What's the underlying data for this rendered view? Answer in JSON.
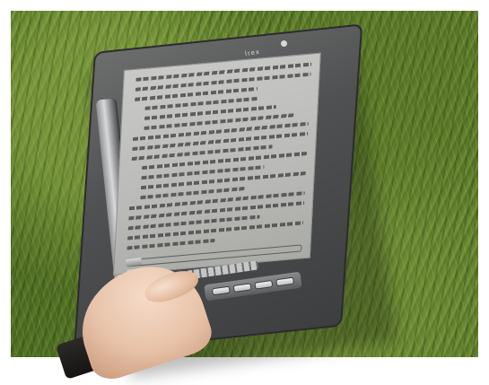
{
  "photo": {
    "subject": "e-book-reader",
    "background": "grass",
    "brand_text": "lrex"
  },
  "colors": {
    "grass": "#5f7d2e",
    "device_body": "#505152",
    "screen": "#b9bab7",
    "hand": "#e7c2a8"
  }
}
